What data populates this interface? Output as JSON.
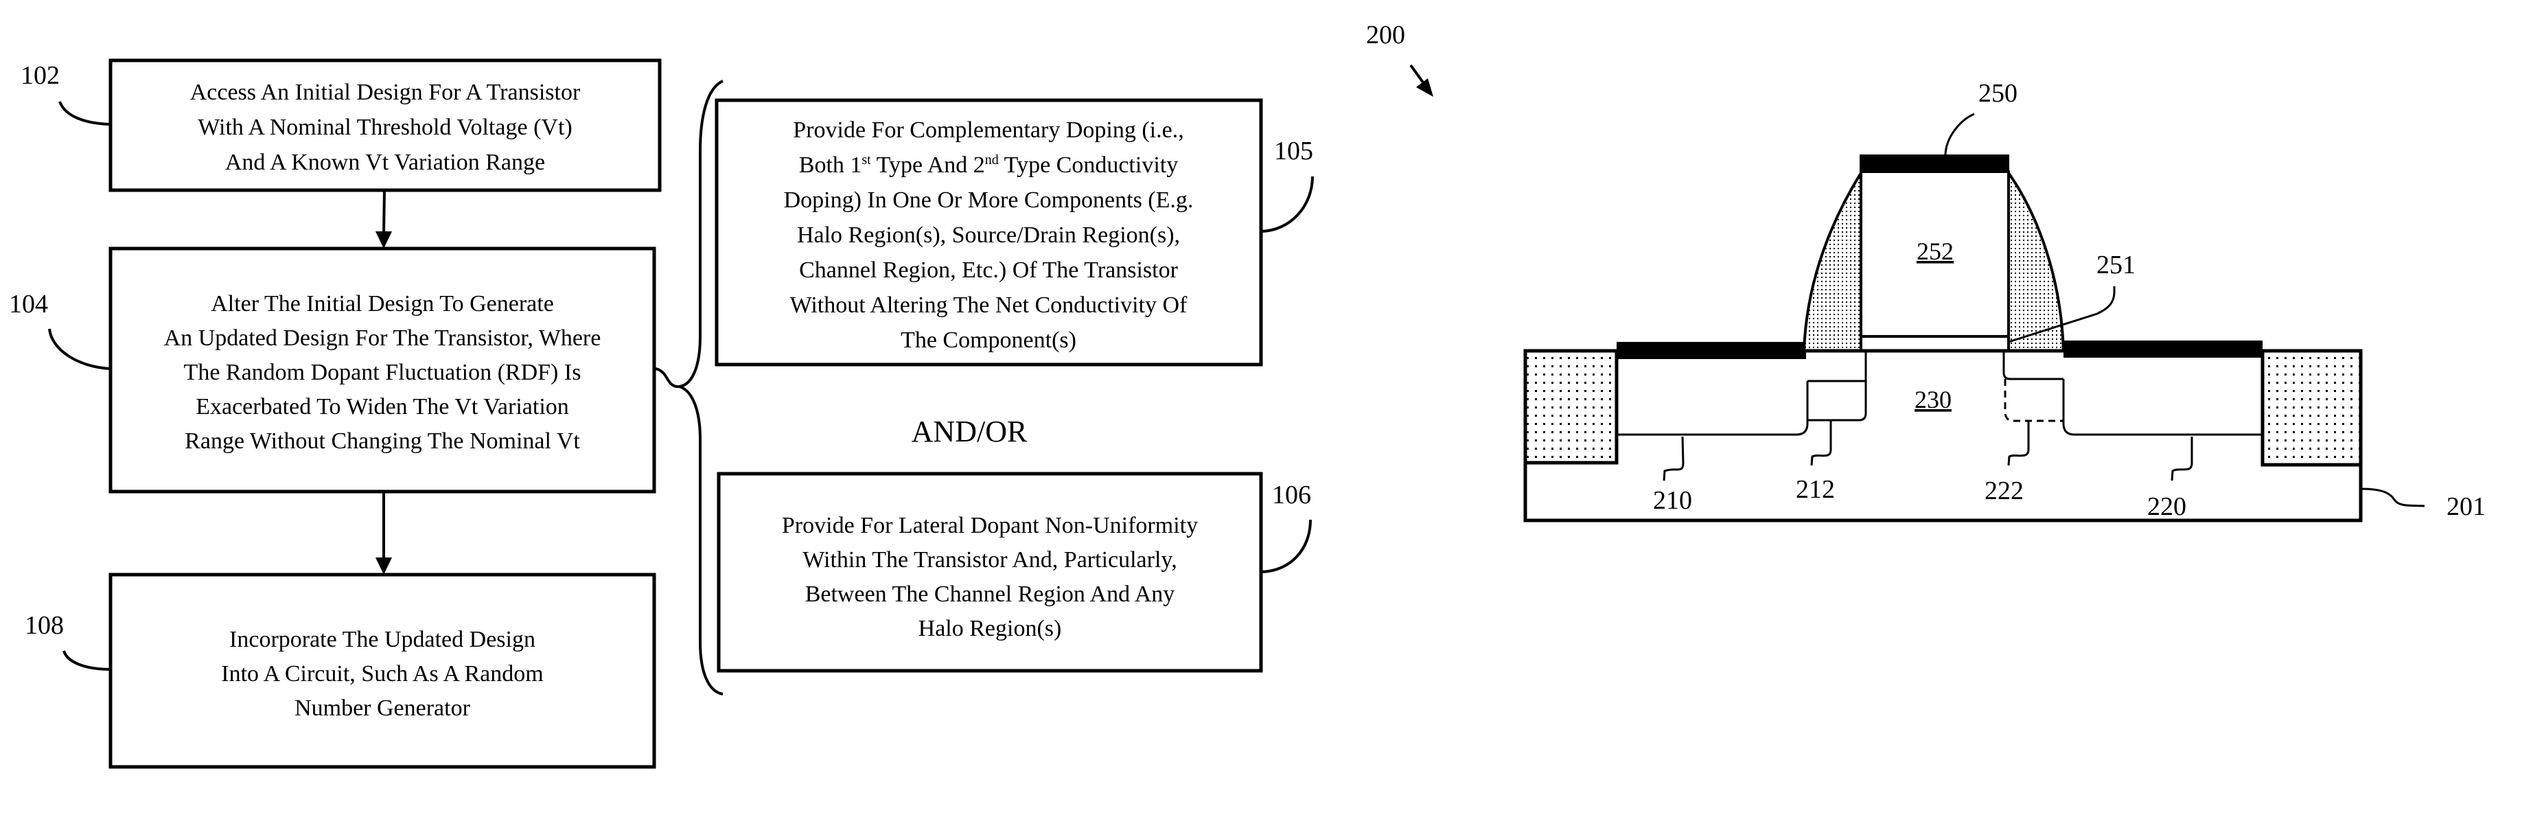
{
  "flowchart": {
    "steps": [
      {
        "ref": "102",
        "lines": [
          "Access An Initial Design For A Transistor",
          "With A Nominal Threshold Voltage (Vt)",
          "And A Known Vt Variation Range"
        ]
      },
      {
        "ref": "104",
        "lines": [
          "Alter The Initial Design To Generate",
          "An Updated Design For The Transistor, Where",
          "The Random Dopant Fluctuation (RDF) Is",
          "Exacerbated To Widen The Vt Variation",
          "Range Without Changing The Nominal Vt"
        ]
      },
      {
        "ref": "108",
        "lines": [
          "Incorporate The Updated Design",
          "Into A Circuit, Such As A Random",
          "Number Generator"
        ]
      }
    ],
    "options": [
      {
        "ref": "105",
        "lines": [
          "Provide For Complementary Doping (i.e.,",
          "Both 1",
          "Doping) In One Or More Components (E.g.",
          "Halo Region(s), Source/Drain Region(s),",
          "Channel Region, Etc.) Of The Transistor",
          "Without Altering The Net Conductivity Of",
          "The Component(s)"
        ],
        "line2_parts": [
          "Both 1",
          "st",
          " Type And 2",
          "nd",
          " Type Conductivity"
        ]
      },
      {
        "ref": "106",
        "lines": [
          "Provide For Lateral Dopant Non-Uniformity",
          "Within The Transistor And, Particularly,",
          "Between The Channel Region And Any",
          "Halo Region(s)"
        ]
      }
    ],
    "connector_text": "AND/OR"
  },
  "transistor": {
    "figure_ref": "200",
    "refs": {
      "substrate": "201",
      "source_drain_left": "210",
      "halo_left": "212",
      "source_drain_right": "220",
      "halo_right": "222",
      "channel": "230",
      "gate_cap": "250",
      "gate_dielectric": "251",
      "gate_body": "252"
    }
  }
}
